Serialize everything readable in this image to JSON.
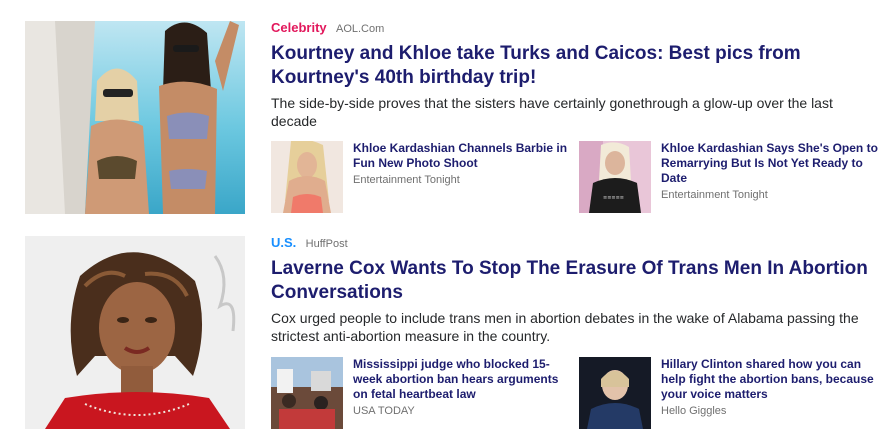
{
  "stories": [
    {
      "category": "Celebrity",
      "category_color": "#e2185c",
      "source": "AOL.Com",
      "headline": "Kourtney and Khloe take Turks and Caicos: Best pics from Kourtney's 40th birthday trip!",
      "summary": "The side-by-side proves that the sisters have certainly gonethrough a glow-up over the last decade",
      "related": [
        {
          "title": "Khloe Kardashian Channels Barbie in Fun New Photo Shoot",
          "source": "Entertainment Tonight"
        },
        {
          "title": "Khloe Kardashian Says She's Open to Remarrying But Is Not Yet Ready to Date",
          "source": "Entertainment Tonight"
        }
      ]
    },
    {
      "category": "U.S.",
      "category_color": "#188fff",
      "source": "HuffPost",
      "headline": "Laverne Cox Wants To Stop The Erasure Of Trans Men In Abortion Conversations",
      "summary": "Cox urged people to include trans men in abortion debates in the wake of Alabama passing the strictest anti-abortion measure in the country.",
      "related": [
        {
          "title": "Mississippi judge who blocked 15-week abortion ban hears arguments on fetal heartbeat law",
          "source": "USA TODAY"
        },
        {
          "title": "Hillary Clinton shared how you can help fight the abortion bans, because your voice matters",
          "source": "Hello Giggles"
        }
      ]
    }
  ]
}
